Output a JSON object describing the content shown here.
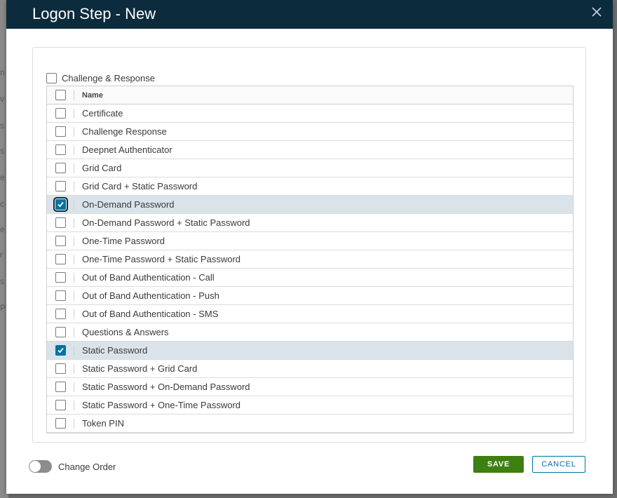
{
  "background": {
    "fragments": [
      "n",
      "v",
      "s",
      "s",
      "e",
      "c",
      "e",
      "r",
      "s",
      "P"
    ]
  },
  "modal": {
    "title": "Logon Step - New",
    "close_icon": "close-icon"
  },
  "challenge_response": {
    "label": "Challenge & Response",
    "checked": false
  },
  "grid": {
    "header": "Name",
    "rows": [
      {
        "name": "Certificate",
        "checked": false
      },
      {
        "name": "Challenge Response",
        "checked": false
      },
      {
        "name": "Deepnet Authenticator",
        "checked": false
      },
      {
        "name": "Grid Card",
        "checked": false
      },
      {
        "name": "Grid Card + Static Password",
        "checked": false
      },
      {
        "name": "On-Demand Password",
        "checked": true,
        "focused": true
      },
      {
        "name": "On-Demand Password + Static Password",
        "checked": false
      },
      {
        "name": "One-Time Password",
        "checked": false
      },
      {
        "name": "One-Time Password + Static Password",
        "checked": false
      },
      {
        "name": "Out of Band Authentication - Call",
        "checked": false
      },
      {
        "name": "Out of Band Authentication - Push",
        "checked": false
      },
      {
        "name": "Out of Band Authentication - SMS",
        "checked": false
      },
      {
        "name": "Questions & Answers",
        "checked": false
      },
      {
        "name": "Static Password",
        "checked": true
      },
      {
        "name": "Static Password + Grid Card",
        "checked": false
      },
      {
        "name": "Static Password + On-Demand Password",
        "checked": false
      },
      {
        "name": "Static Password + One-Time Password",
        "checked": false
      },
      {
        "name": "Token PIN",
        "checked": false
      }
    ]
  },
  "footer": {
    "toggle_label": "Change Order",
    "toggle_on": false,
    "save_label": "SAVE",
    "cancel_label": "CANCEL"
  },
  "colors": {
    "header_bg": "#0c2b3d",
    "checked_bg": "#0072a3",
    "selected_row": "#dae3ea",
    "save_bg": "#3d7f10",
    "cancel_text": "#0072a3"
  }
}
